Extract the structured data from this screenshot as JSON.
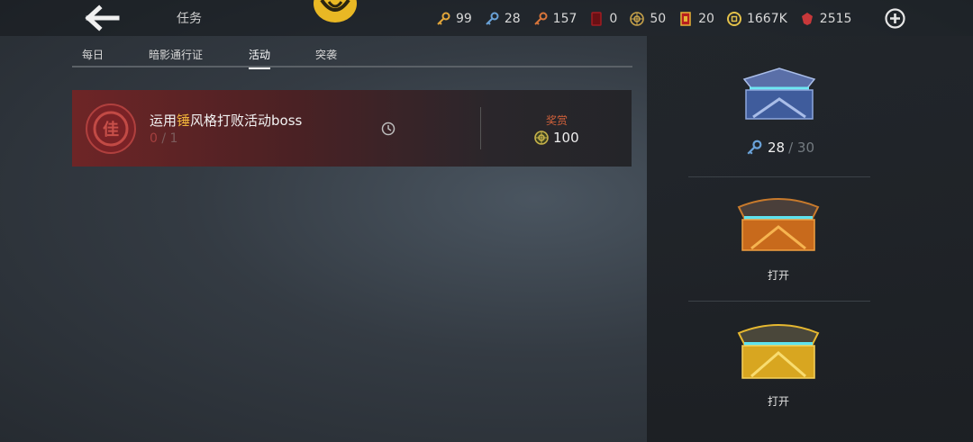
{
  "header": {
    "back_icon": "arrow-left-icon",
    "title": "任务",
    "emblem_icon": "gold-emblem-icon",
    "currencies": [
      {
        "icon": "gold-key-icon",
        "value": "99",
        "color": "#e3a63a"
      },
      {
        "icon": "blue-key-icon",
        "value": "28",
        "color": "#6aa2d8"
      },
      {
        "icon": "orange-key-icon",
        "value": "157",
        "color": "#d9753a"
      },
      {
        "icon": "red-card-icon",
        "value": "0",
        "color": "#a11c22"
      },
      {
        "icon": "gear-coin-icon",
        "value": "50",
        "color": "#c7a24a"
      },
      {
        "icon": "ticket-icon",
        "value": "20",
        "color": "#e7b136"
      },
      {
        "icon": "gold-coin-icon",
        "value": "1667K",
        "color": "#e3c14a"
      },
      {
        "icon": "red-gem-icon",
        "value": "2515",
        "color": "#c8383a"
      }
    ],
    "add_icon": "plus-circle-icon"
  },
  "tabs": [
    {
      "label": "每日",
      "active": false
    },
    {
      "label": "暗影通行证",
      "active": false
    },
    {
      "label": "活动",
      "active": true
    },
    {
      "label": "突袭",
      "active": false
    }
  ],
  "task": {
    "icon": "red-badge-icon",
    "badge_char": "佳",
    "title_before": "运用",
    "title_highlight": "锤",
    "title_after": "风格打败活动boss",
    "progress_current": "0",
    "progress_sep": "/",
    "progress_total": "1",
    "clock_icon": "clock-icon",
    "reward_label": "奖赏",
    "reward_icon": "gear-coin-icon",
    "reward_value": "100"
  },
  "side": {
    "chest1_icon": "blue-chest-icon",
    "key_icon": "blue-key-icon",
    "key_current": "28",
    "key_max": "/ 30",
    "chest2_icon": "orange-chest-icon",
    "chest2_action": "打开",
    "chest3_icon": "gold-chest-icon",
    "chest3_action": "打开"
  }
}
